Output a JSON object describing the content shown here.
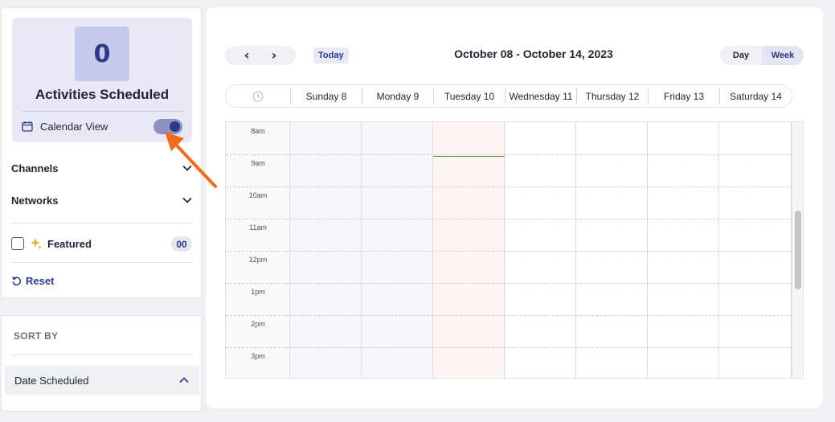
{
  "sidebar": {
    "activities_count": "0",
    "activities_label": "Activities Scheduled",
    "calendar_view_label": "Calendar View",
    "calendar_view_enabled": true,
    "channels_label": "Channels",
    "networks_label": "Networks",
    "featured_label": "Featured",
    "featured_count": "00",
    "reset_label": "Reset"
  },
  "sort": {
    "title": "SORT BY",
    "selected": "Date Scheduled"
  },
  "calendar": {
    "prev_label": "‹",
    "next_label": "›",
    "today_label": "Today",
    "date_range": "October 08 - October 14, 2023",
    "view_day": "Day",
    "view_week": "Week",
    "active_view": "Week",
    "days": [
      "Sunday 8",
      "Monday 9",
      "Tuesday 10",
      "Wednesday 11",
      "Thursday 12",
      "Friday 13",
      "Saturday 14"
    ],
    "times": [
      "8am",
      "9am",
      "10am",
      "11am",
      "12pm",
      "1pm",
      "2pm",
      "3pm"
    ],
    "today_index": 2
  },
  "colors": {
    "accent": "#2b3a85",
    "annotation_arrow": "#f26a1b",
    "today_column": "#fdf6f2",
    "now_line": "#4f8a3a"
  }
}
